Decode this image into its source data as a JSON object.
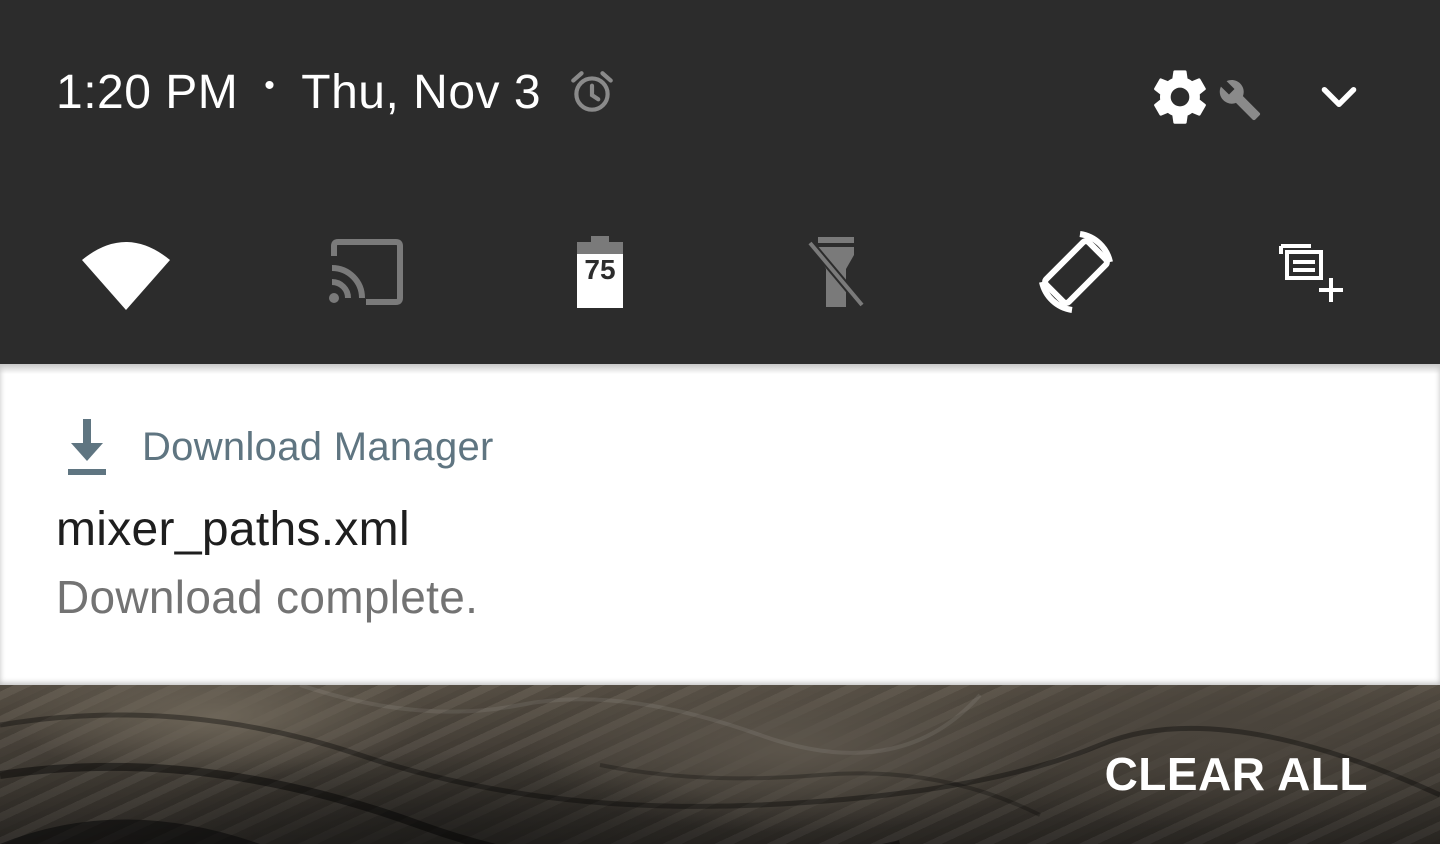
{
  "status": {
    "time": "1:20 PM",
    "separator": "•",
    "date": "Thu, Nov 3",
    "alarm_icon": "alarm-clock-icon"
  },
  "header_actions": {
    "settings_icon": "gear-icon",
    "system_ui_tuner_icon": "wrench-icon",
    "expand_icon": "chevron-down-icon"
  },
  "quick_tiles": [
    {
      "name": "wifi",
      "icon": "wifi-icon",
      "active": true
    },
    {
      "name": "cast",
      "icon": "cast-icon",
      "active": false
    },
    {
      "name": "battery",
      "icon": "battery-icon",
      "level_text": "75",
      "active": true
    },
    {
      "name": "flashlight",
      "icon": "flashlight-off-icon",
      "active": false
    },
    {
      "name": "auto-rotate",
      "icon": "screen-rotation-icon",
      "active": true
    },
    {
      "name": "add-tile",
      "icon": "add-tile-icon",
      "active": true
    }
  ],
  "notification": {
    "app_icon": "download-icon",
    "app_name": "Download Manager",
    "title": "mixer_paths.xml",
    "text": "Download complete."
  },
  "footer": {
    "clear_all_label": "CLEAR ALL"
  },
  "colors": {
    "shade_bg": "#2c2c2c",
    "icon_active": "#ffffff",
    "icon_inactive": "#7a7a7a",
    "app_name": "#5f7581",
    "notif_text": "#737373"
  }
}
